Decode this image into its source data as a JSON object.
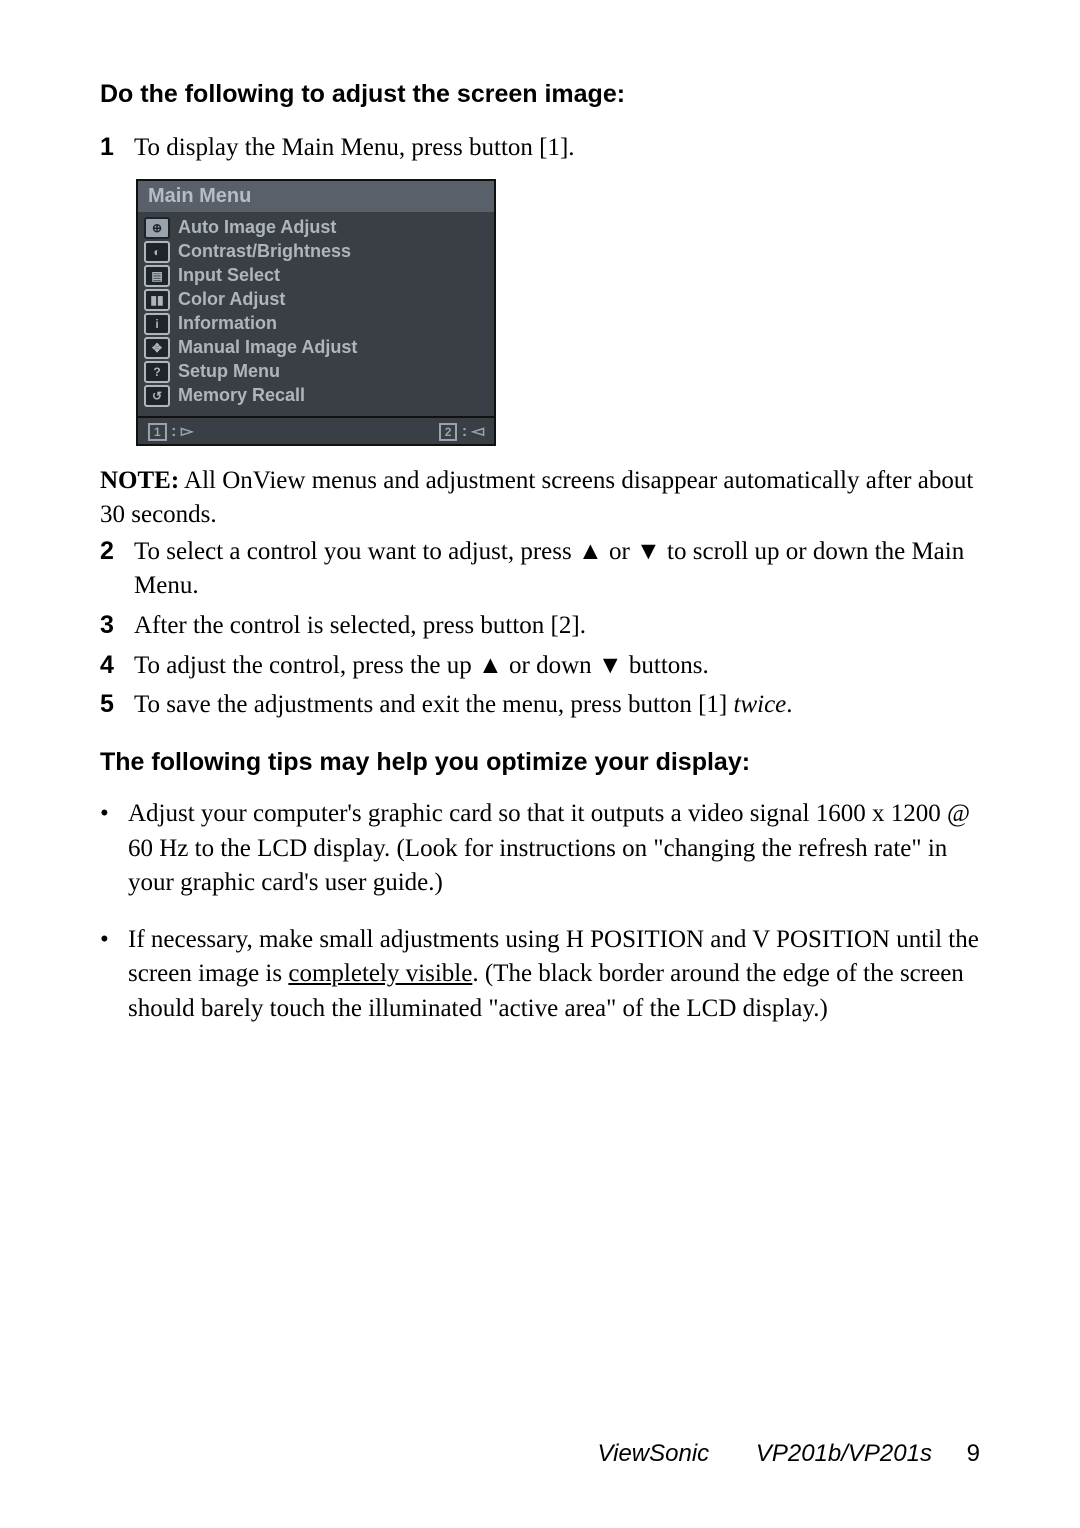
{
  "heading1": "Do the following to adjust the screen image:",
  "step1_num": "1",
  "step1_text": "To display the Main Menu, press button [1].",
  "menu": {
    "title": "Main Menu",
    "items": [
      {
        "icon": "⊕",
        "label": "Auto Image Adjust"
      },
      {
        "icon": "◐",
        "label": "Contrast/Brightness"
      },
      {
        "icon": "▤",
        "label": "Input Select"
      },
      {
        "icon": "▮▮",
        "label": "Color Adjust"
      },
      {
        "icon": "i",
        "label": "Information"
      },
      {
        "icon": "✥",
        "label": "Manual Image Adjust"
      },
      {
        "icon": "?",
        "label": "Setup Menu"
      },
      {
        "icon": "↺",
        "label": "Memory Recall"
      }
    ],
    "foot_left_box": "1",
    "foot_left_arrow": ": ▻",
    "foot_right_box": "2",
    "foot_right_arrow": ": ◅"
  },
  "note_lead": "NOTE:",
  "note_text": " All OnView menus and adjustment screens disappear automatically after about 30 seconds.",
  "step2_num": "2",
  "step2_text": "To select a control you want to adjust, press ▲ or ▼ to scroll up or down the Main Menu.",
  "step3_num": "3",
  "step3_text": "After the control is selected, press button [2].",
  "step4_num": "4",
  "step4_text": "To adjust the control, press the up ▲ or down ▼ buttons.",
  "step5_num": "5",
  "step5_text_a": "To save the adjustments and exit the menu, press button [1] ",
  "step5_text_b": "twice",
  "step5_text_c": ".",
  "heading2": "The following tips may help you optimize your display:",
  "tip1": "Adjust your computer's graphic card so that it outputs a video signal 1600 x 1200 @ 60 Hz to the LCD display. (Look for instructions on \"changing the refresh rate\" in your graphic card's user guide.)",
  "tip2_a": "If necessary, make small adjustments using H POSITION and V POSITION until the screen image is ",
  "tip2_b": "completely visible",
  "tip2_c": ". (The black border around the edge of the screen should barely touch the illuminated \"active area\" of the LCD display.)",
  "footer_brand": "ViewSonic",
  "footer_model": "VP201b/VP201s",
  "footer_page": "9"
}
